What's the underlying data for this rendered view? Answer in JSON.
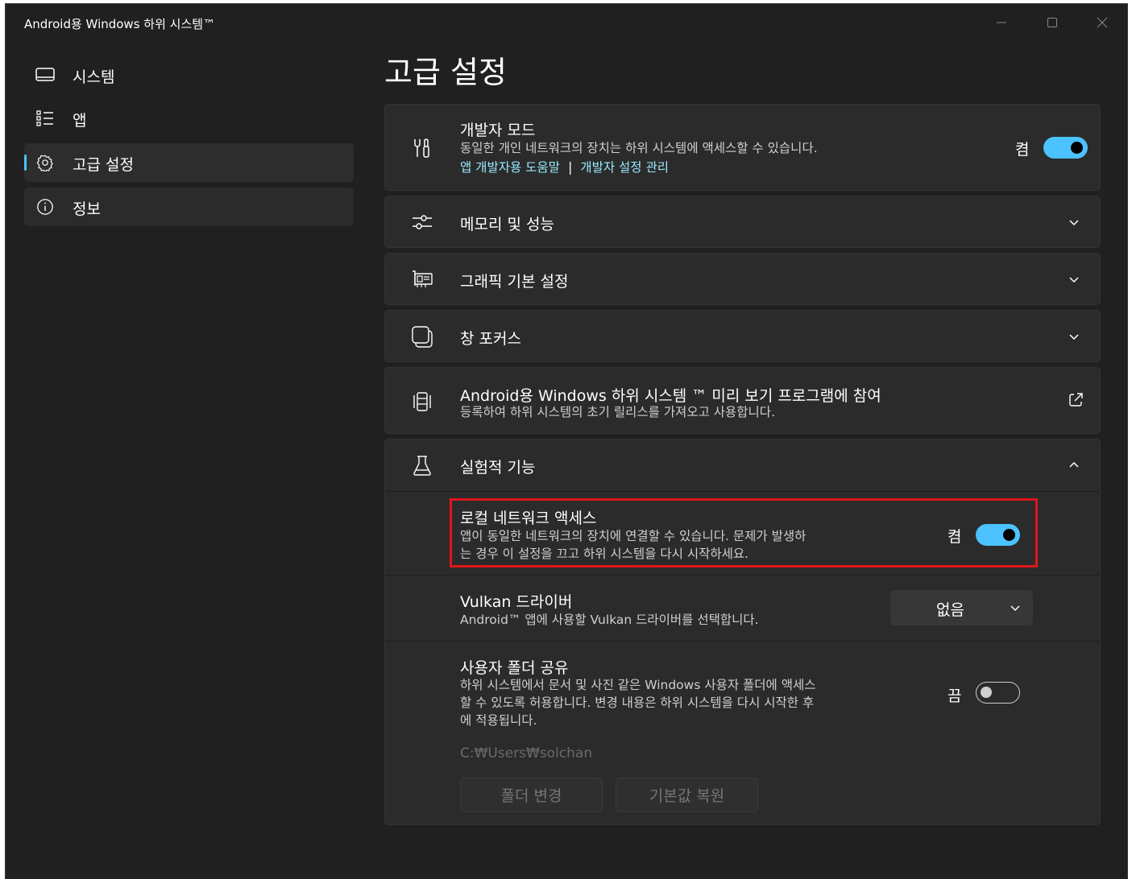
{
  "window": {
    "title": "Android용 Windows 하위 시스템™",
    "controls": [
      "minimize-icon",
      "maximize-icon",
      "close-icon"
    ]
  },
  "sidebar": {
    "items": [
      {
        "label": "시스템",
        "icon": "monitor-icon",
        "selected": false
      },
      {
        "label": "앱",
        "icon": "list-icon",
        "selected": false
      },
      {
        "label": "고급 설정",
        "icon": "gear-icon",
        "selected": true
      },
      {
        "label": "정보",
        "icon": "info-icon",
        "selected": false
      }
    ]
  },
  "page": {
    "title": "고급 설정"
  },
  "developer_mode": {
    "title": "개발자 모드",
    "desc": "동일한 개인 네트워크의 장치는 하위 시스템에 액세스할 수 있습니다.",
    "link1": "앱 개발자용 도움말",
    "separator": "|",
    "link2": "개발자 설정 관리",
    "toggle_label": "켬",
    "toggle_on": true
  },
  "memory": {
    "title": "메모리 및 성능"
  },
  "graphics": {
    "title": "그래픽 기본 설정"
  },
  "focus": {
    "title": "창 포커스"
  },
  "preview": {
    "title": "Android용 Windows 하위 시스템 ™ 미리 보기 프로그램에 참여",
    "desc": "등록하여 하위 시스템의 초기 릴리스를 가져오고 사용합니다."
  },
  "experimental": {
    "title": "실험적 기능",
    "local_network": {
      "title": "로컬 네트워크 액세스",
      "desc_line1": "앱이 동일한 네트워크의 장치에 연결할 수 있습니다. 문제가 발생하",
      "desc_line2": "는 경우 이 설정을 끄고 하위 시스템을 다시 시작하세요.",
      "toggle_label": "켬",
      "toggle_on": true
    },
    "vulkan": {
      "title": "Vulkan 드라이버",
      "desc": "Android™ 앱에 사용할 Vulkan 드라이버를 선택합니다.",
      "selected": "없음"
    },
    "user_folder": {
      "title": "사용자 폴더 공유",
      "desc_line1": "하위 시스템에서 문서 및 사진 같은 Windows 사용자 폴더에 액세스",
      "desc_line2": "할 수 있도록 허용합니다. 변경 내용은 하위 시스템을 다시 시작한 후",
      "desc_line3": "에 적용됩니다.",
      "toggle_label": "끔",
      "toggle_on": false,
      "path": "C:₩Users₩solchan",
      "change_button": "폴더 변경",
      "reset_button": "기본값 복원"
    }
  },
  "colors": {
    "accent": "#4cc2ff",
    "link": "#99ebff",
    "highlight": "#e0161b",
    "background": "#202020",
    "card": "#2b2b2b"
  }
}
